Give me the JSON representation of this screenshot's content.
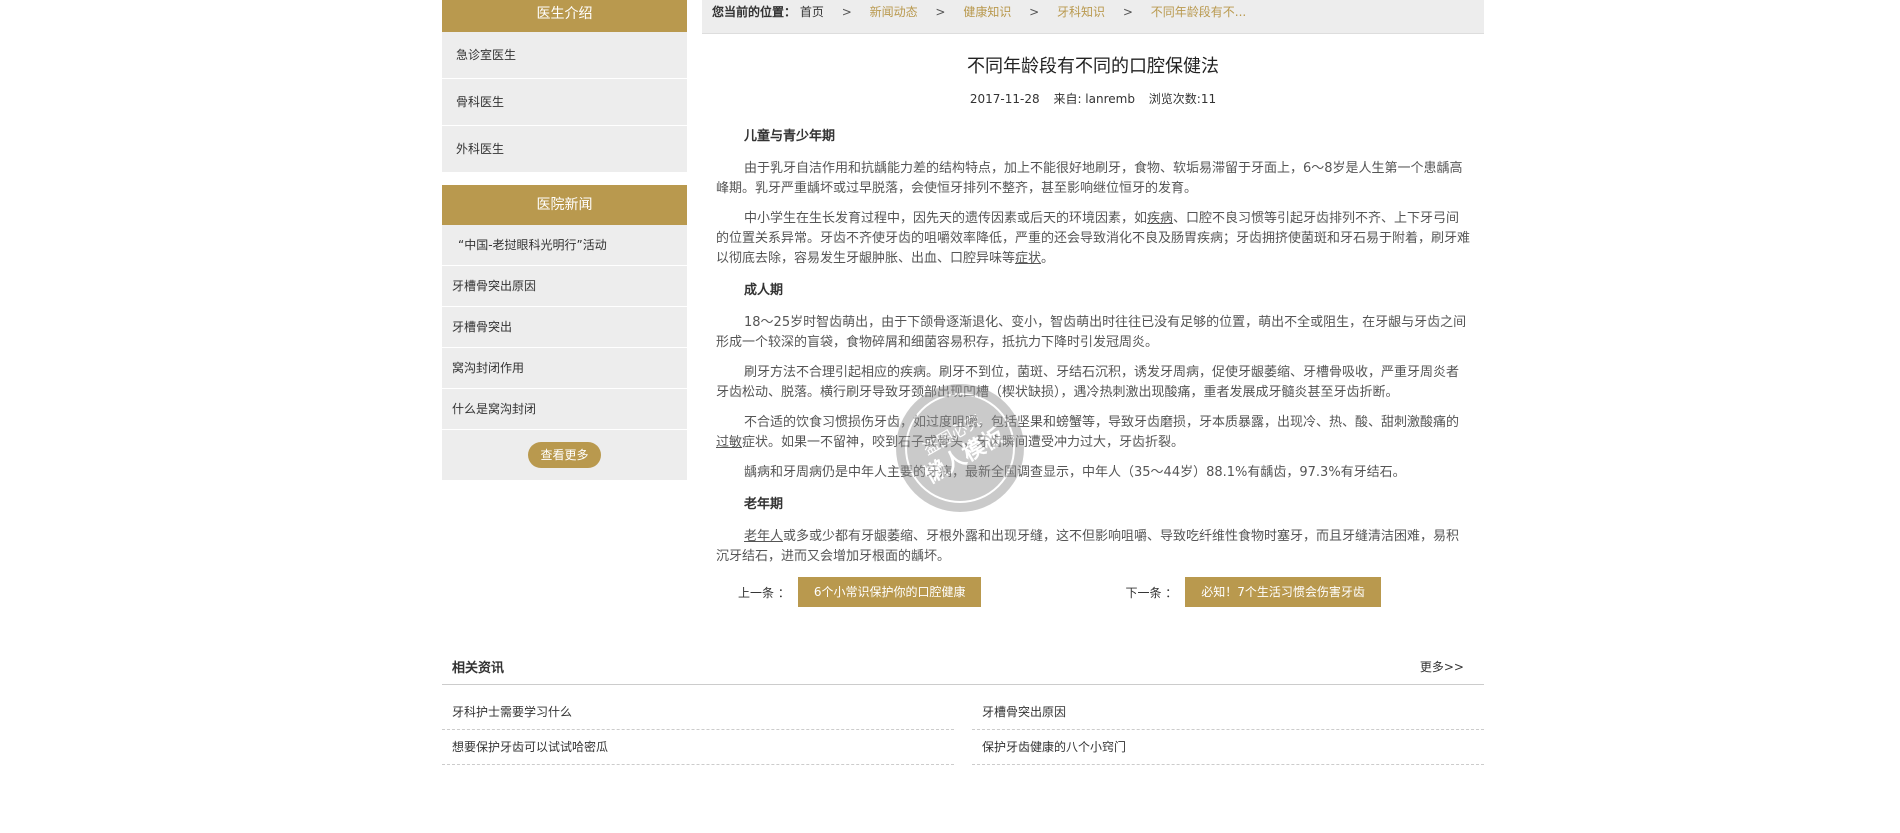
{
  "sidebar": {
    "doctors_title": "医生介绍",
    "doctors": [
      "急诊室医生",
      "骨科医生",
      "外科医生"
    ],
    "news_title": "医院新闻",
    "news": [
      "“中国-老挝眼科光明行”活动",
      "牙槽骨突出原因",
      "牙槽骨突出",
      "窝沟封闭作用",
      "什么是窝沟封闭"
    ],
    "more_label": "查看更多"
  },
  "breadcrumb": {
    "prefix": "您当前的位置：",
    "sep": ">",
    "items": [
      "首页",
      "新闻动态",
      "健康知识",
      "牙科知识",
      "不同年龄段有不..."
    ]
  },
  "article": {
    "title": "不同年龄段有不同的口腔保健法",
    "date": "2017-11-28",
    "source": "来自: lanremb",
    "views": "浏览次数:11",
    "h1": "儿童与青少年期",
    "p1": "由于乳牙自洁作用和抗龋能力差的结构特点，加上不能很好地刷牙，食物、软垢易滞留于牙面上，6～8岁是人生第一个患龋高峰期。乳牙严重龋坏或过早脱落，会使恒牙排列不整齐，甚至影响继位恒牙的发育。",
    "p2a": "中小学生在生长发育过程中，因先天的遗传因素或后天的环境因素，如",
    "p2u1": "疾病",
    "p2b": "、口腔不良习惯等引起牙齿排列不齐、上下牙弓间的位置关系异常。牙齿不齐使牙齿的咀嚼效率降低，严重的还会导致消化不良及肠胃疾病；牙齿拥挤使菌斑和牙石易于附着，刷牙难以彻底去除，容易发生牙龈肿胀、出血、口腔异味等",
    "p2u2": "症状",
    "p2c": "。",
    "h2": "成人期",
    "p3": "18～25岁时智齿萌出，由于下颌骨逐渐退化、变小，智齿萌出时往往已没有足够的位置，萌出不全或阻生，在牙龈与牙齿之间形成一个较深的盲袋，食物碎屑和细菌容易积存，抵抗力下降时引发冠周炎。",
    "p4": "刷牙方法不合理引起相应的疾病。刷牙不到位，菌斑、牙结石沉积，诱发牙周病，促使牙龈萎缩、牙槽骨吸收，严重牙周炎者牙齿松动、脱落。横行刷牙导致牙颈部出现凹槽（楔状缺损），遇冷热刺激出现酸痛，重者发展成牙髓炎甚至牙齿折断。",
    "p5a": "不合适的饮食习惯损伤牙齿，如过度咀嚼，包括坚果和螃蟹等，导致牙齿磨损，牙本质暴露，出现冷、热、酸、甜刺激酸痛的",
    "p5u": "过敏",
    "p5b": "症状。如果一不留神，咬到石子或骨头，牙齿瞬间遭受冲力过大，牙齿折裂。",
    "p6": "龋病和牙周病仍是中年人主要的牙病，最新全国调查显示，中年人（35～44岁）88.1%有龋齿，97.3%有牙结石。",
    "h3": "老年期",
    "p7u": "老年人",
    "p7": "或多或少都有牙龈萎缩、牙根外露和出现牙缝，这不但影响咀嚼、导致吃纤维性食物时塞牙，而且牙缝清洁困难，易积沉牙结石，进而又会增加牙根面的龋坏。"
  },
  "pager": {
    "prev_label": "上一条 ：",
    "prev_title": "6个小常识保护你的口腔健康",
    "next_label": "下一条 ：",
    "next_title": "必知！7个生活习惯会伤害牙齿"
  },
  "related": {
    "title": "相关资讯",
    "more": "更多>>",
    "left": [
      "牙科护士需要学习什么",
      "想要保护牙齿可以试试哈密瓜"
    ],
    "right": [
      "牙槽骨突出原因",
      "保护牙齿健康的八个小窍门"
    ]
  },
  "watermark": {
    "line1": "盗图必究",
    "line2": "懒人模板"
  },
  "colors": {
    "accent": "#b9994e",
    "panel": "#ededed"
  }
}
